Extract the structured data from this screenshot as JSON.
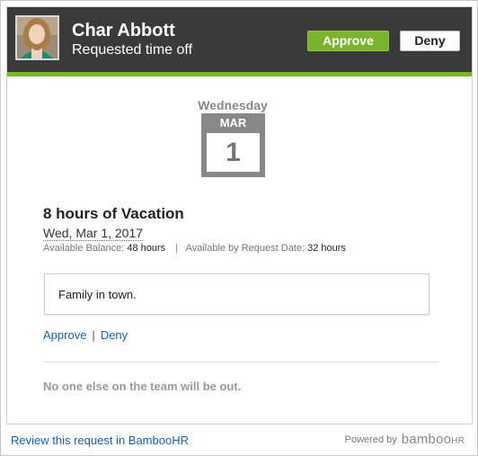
{
  "header": {
    "name": "Char Abbott",
    "subtitle": "Requested time off",
    "approve_label": "Approve",
    "deny_label": "Deny"
  },
  "calendar": {
    "weekday": "Wednesday",
    "month": "MAR",
    "day": "1"
  },
  "request": {
    "title": "8 hours of Vacation",
    "date": "Wed, Mar 1, 2017",
    "available_balance_label": "Available Balance:",
    "available_balance_value": "48 hours",
    "separator": "|",
    "by_date_label": "Available by Request Date:",
    "by_date_value": "32 hours",
    "note": "Family in town."
  },
  "actions": {
    "approve_link": "Approve",
    "separator": "|",
    "deny_link": "Deny"
  },
  "team_status": "No one else on the team will be out.",
  "footer": {
    "review_link": "Review this request in BambooHR",
    "powered_by": "Powered by",
    "brand": "bamboo",
    "brand_suffix": "HR"
  },
  "colors": {
    "accent_green": "#7ab32e",
    "header_bg": "#3a3a3a",
    "link_blue": "#1a5fa8"
  }
}
